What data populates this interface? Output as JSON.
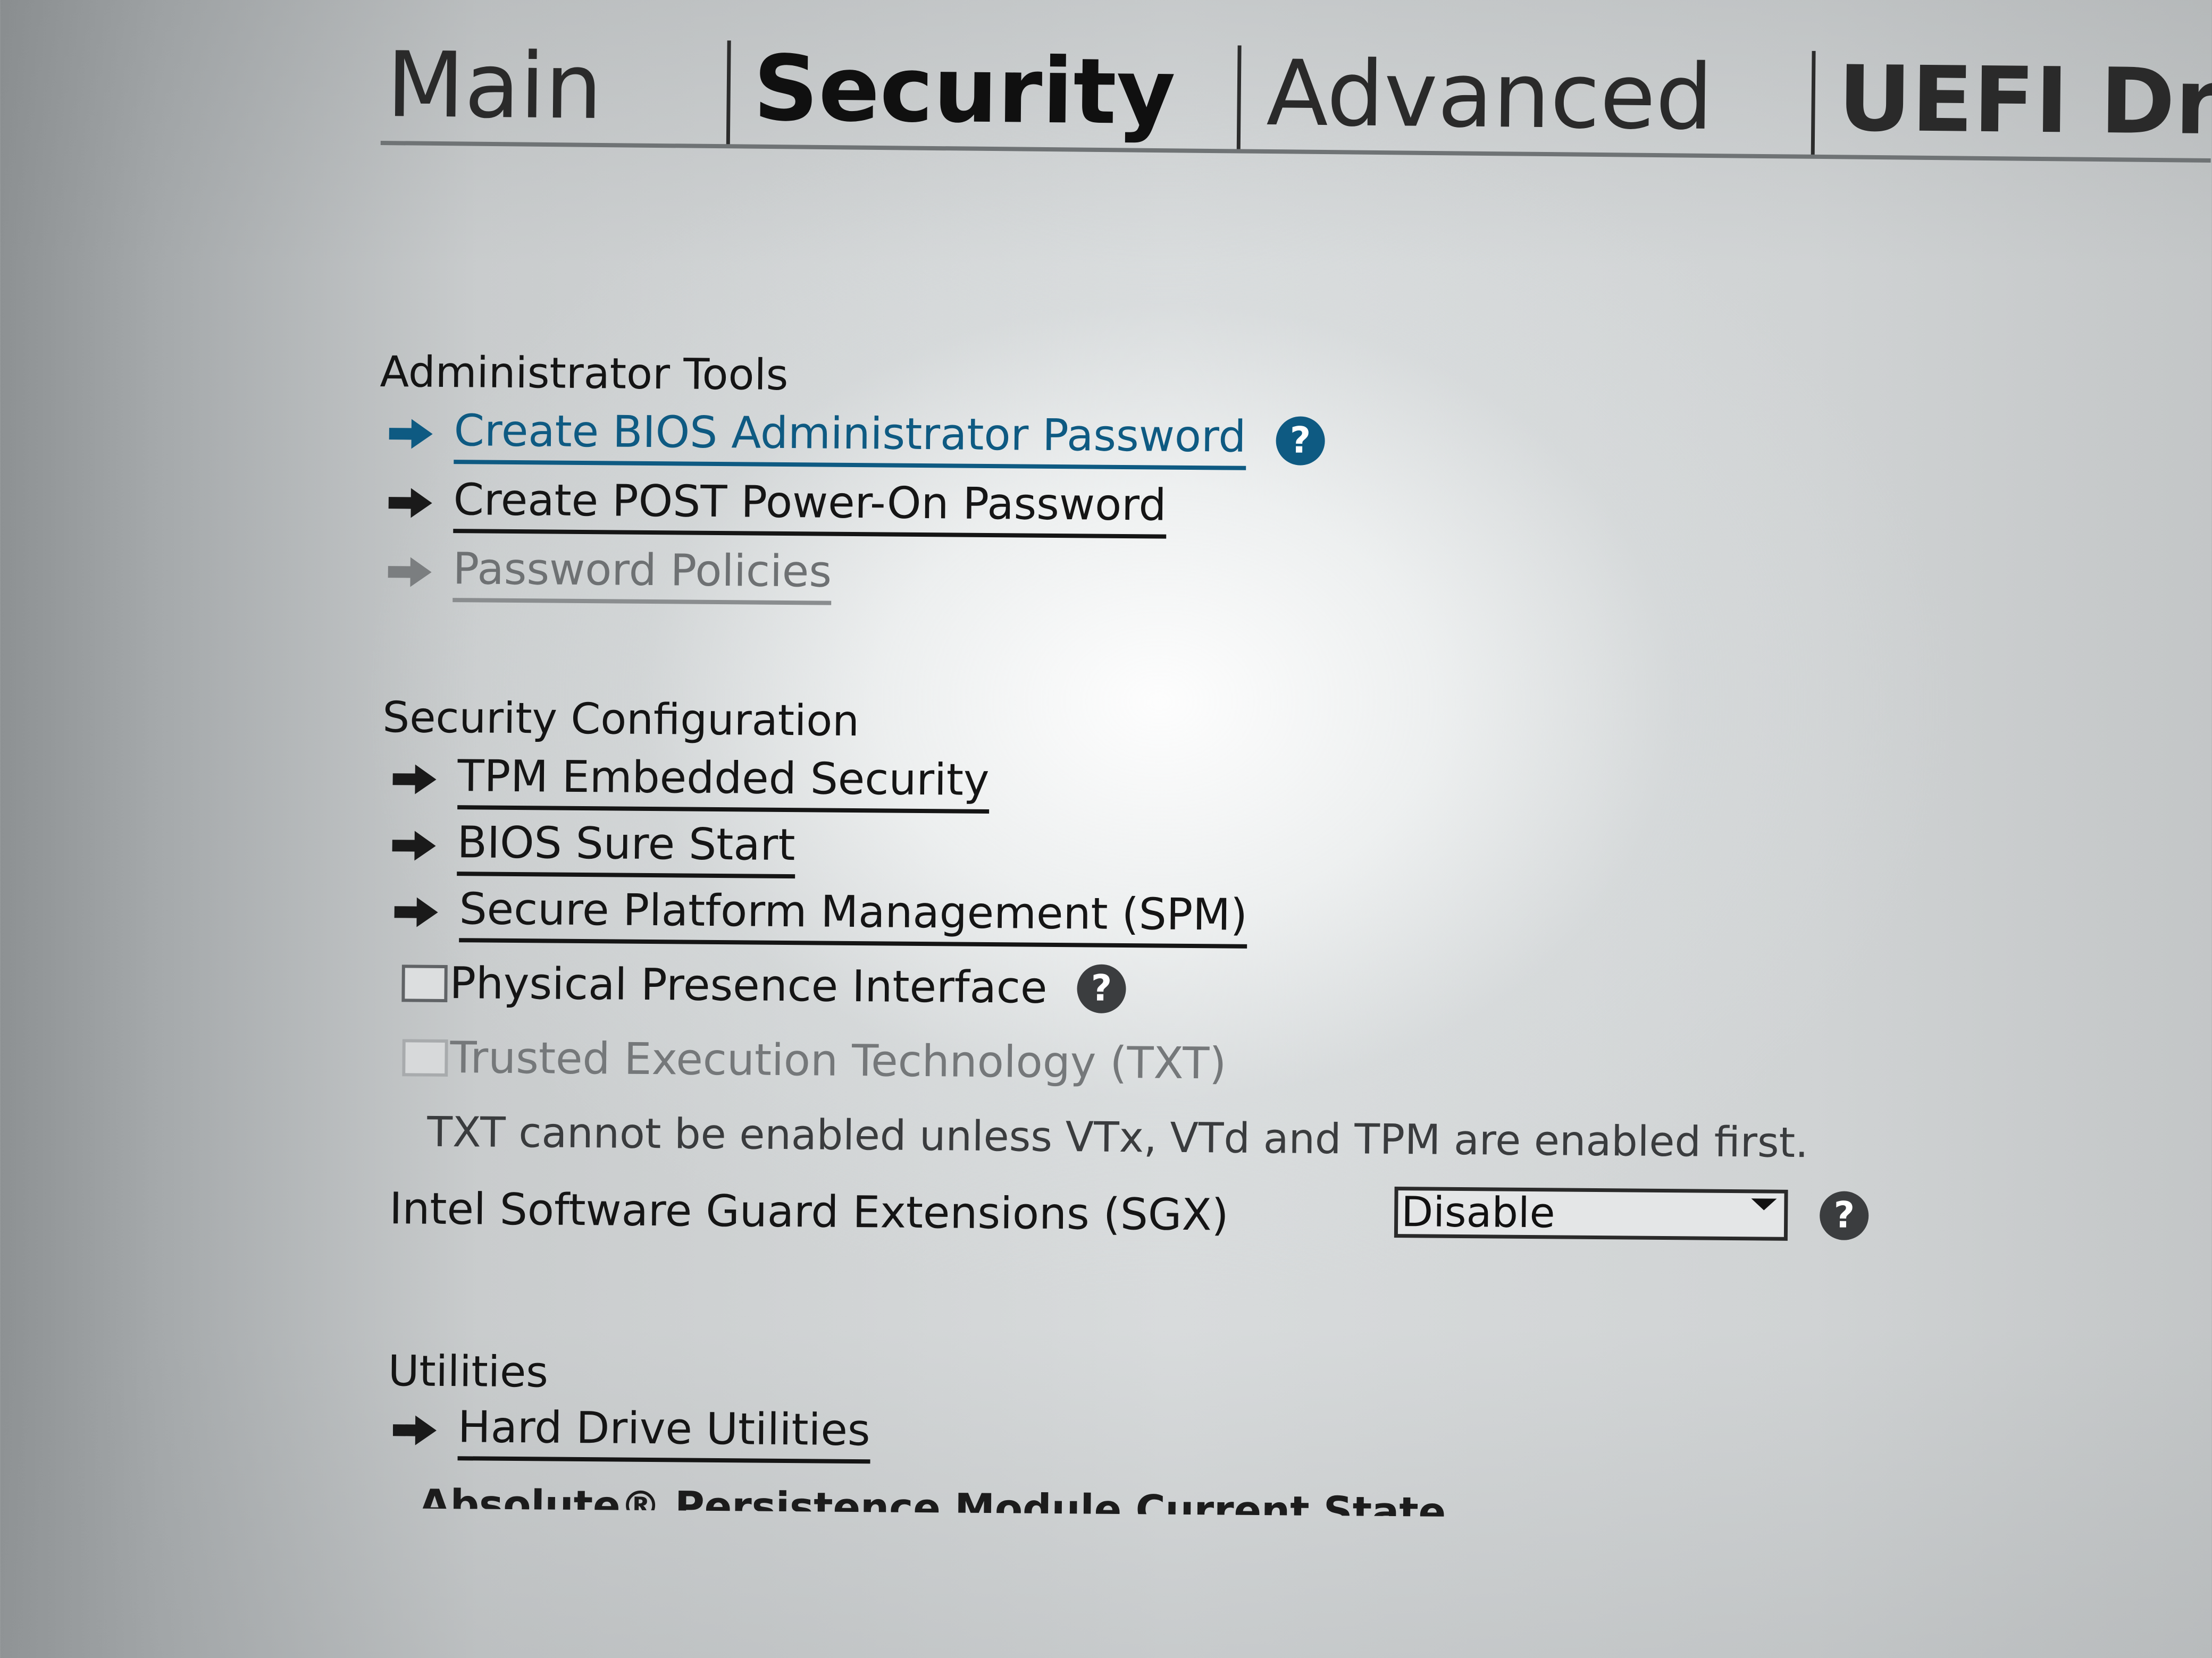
{
  "tabs": [
    {
      "label": "Main"
    },
    {
      "label": "Security"
    },
    {
      "label": "Advanced"
    },
    {
      "label": "UEFI Driv"
    }
  ],
  "sections": {
    "admin_tools": {
      "heading": "Administrator Tools",
      "items": [
        {
          "label": "Create BIOS Administrator Password"
        },
        {
          "label": "Create POST Power-On Password"
        },
        {
          "label": "Password Policies"
        }
      ]
    },
    "security_config": {
      "heading": "Security Configuration",
      "items": [
        {
          "label": "TPM Embedded Security"
        },
        {
          "label": "BIOS Sure Start"
        },
        {
          "label": "Secure Platform Management (SPM)"
        }
      ],
      "physical_presence": {
        "label": "Physical Presence Interface"
      },
      "txt": {
        "label": "Trusted Execution Technology (TXT)"
      },
      "txt_note": "TXT cannot be enabled unless VTx, VTd and TPM are enabled first.",
      "sgx": {
        "label": "Intel Software Guard Extensions (SGX)",
        "value": "Disable"
      }
    },
    "utilities": {
      "heading": "Utilities",
      "items": [
        {
          "label": "Hard Drive Utilities"
        }
      ],
      "absolute_label": "Absolute® Persistence Module Current State"
    }
  },
  "help_glyph": "?",
  "colors": {
    "accent": "#0e5a82",
    "text": "#151515",
    "disabled": "#6e7173"
  }
}
